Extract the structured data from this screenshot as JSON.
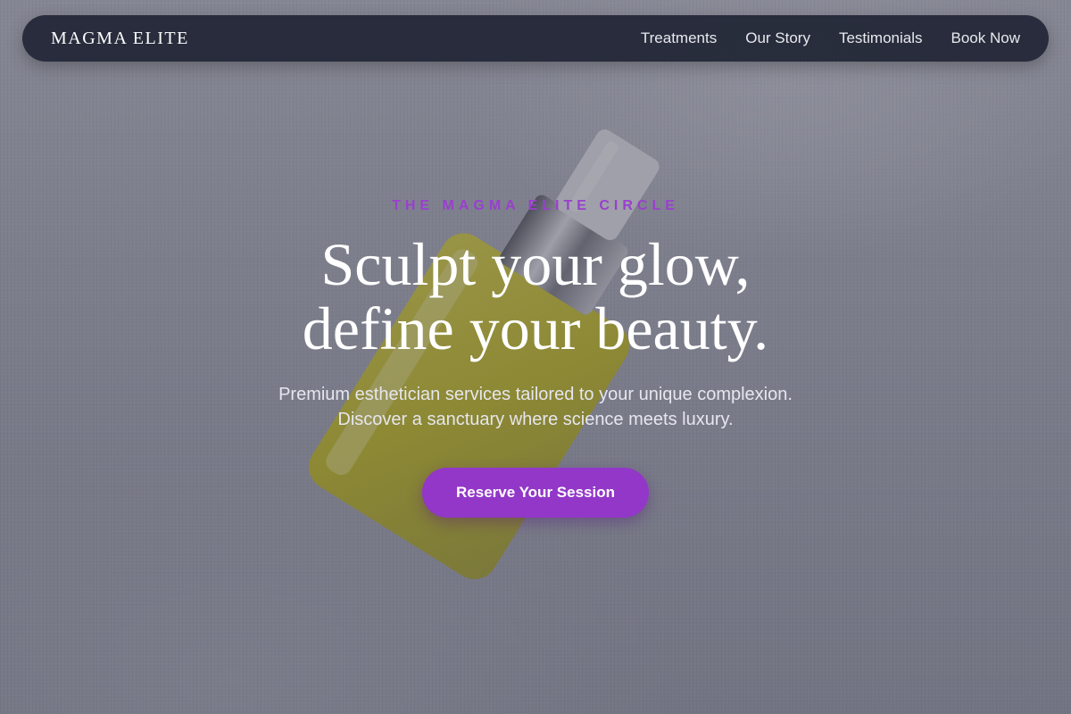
{
  "nav": {
    "brand": "MAGMA ELITE",
    "links": [
      {
        "label": "Treatments"
      },
      {
        "label": "Our Story"
      },
      {
        "label": "Testimonials"
      },
      {
        "label": "Book Now"
      }
    ]
  },
  "hero": {
    "eyebrow": "THE MAGMA ELITE CIRCLE",
    "headline_line1": "Sculpt your glow,",
    "headline_line2": "define your beauty.",
    "subtext_line1": "Premium esthetician services tailored to your unique complexion.",
    "subtext_line2": "Discover a sanctuary where science meets luxury.",
    "cta_label": "Reserve Your Session"
  },
  "colors": {
    "accent": "#9237c8",
    "eyebrow": "#9a3fcf",
    "nav_bg": "#242938"
  }
}
